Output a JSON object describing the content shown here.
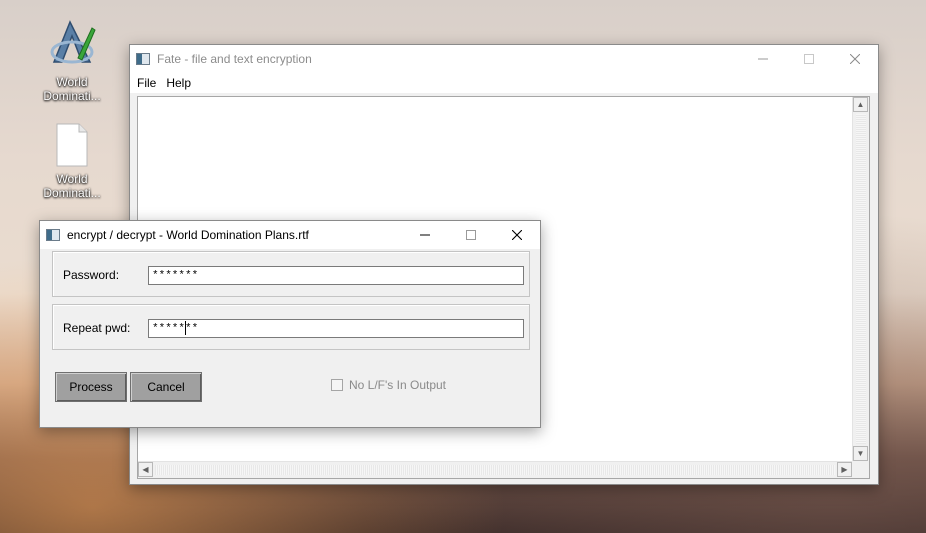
{
  "desktop": {
    "icons": [
      {
        "label_line1": "World",
        "label_line2": "Dominati...",
        "icon": "app-shortcut-icon"
      },
      {
        "label_line1": "World",
        "label_line2": "Dominati...",
        "icon": "document-file-icon"
      }
    ]
  },
  "main_window": {
    "title": "Fate - file and text encryption",
    "menu": [
      {
        "label": "File"
      },
      {
        "label": "Help"
      }
    ],
    "editor_text": "",
    "scroll_up": "▲",
    "scroll_down": "▼",
    "scroll_left": "◀",
    "scroll_right": "▶"
  },
  "dialog": {
    "title": "encrypt / decrypt - World Domination Plans.rtf",
    "password": {
      "label": "Password:",
      "value": "*******"
    },
    "repeat": {
      "label": "Repeat pwd:",
      "value": "*******"
    },
    "process_label": "Process",
    "cancel_label": "Cancel",
    "checkbox_label": "No L/F's In Output",
    "checkbox_checked": false
  },
  "colors": {
    "button_face": "#a0a0a0",
    "disabled_text": "#8a8a8a",
    "window_bg": "#f0f0f0"
  }
}
